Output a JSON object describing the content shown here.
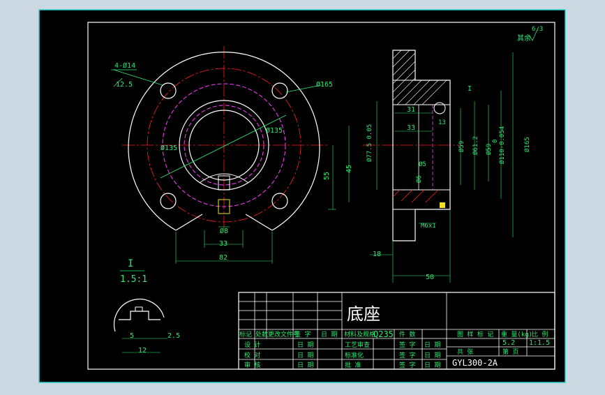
{
  "drawing": {
    "part_name": "底座",
    "material": "Q235",
    "drawing_number": "GYL300-2A",
    "mass": "5.2",
    "scale": "1:1.5",
    "roughness_note": "其余",
    "roughness_value": "6.3",
    "detail_label": "I",
    "detail_scale": "1.5:1",
    "section_mark": "I"
  },
  "front_view_dims": {
    "holes": "4-Ø14",
    "hole_depth": "12.5",
    "outer_dia": "Ø165",
    "pcd_outer": "Ø135",
    "pcd_inner": "Ø135",
    "slot_w": "Ø8",
    "slot_33": "33",
    "width_82": "82",
    "height_55": "55"
  },
  "side_view_dims": {
    "d31": "31",
    "d33": "33",
    "d13": "13",
    "d5": "Ø5",
    "d6": "Ø6",
    "d45": "45",
    "d18": "18",
    "d50": "50",
    "d77": "Ø77.5 0.05",
    "d59a": "Ø59",
    "d612": "Ø61.2",
    "d59b": "Ø59",
    "d110": "Ø110-0.054",
    "d1650": "0",
    "d165": "Ø165",
    "thread": "M6x1"
  },
  "detail_dims": {
    "d5": "5",
    "d25": "2.5",
    "d12": "12"
  },
  "title_block": {
    "h1": "标记",
    "h2": "处数",
    "h3": "更改文件号",
    "h4": "签 字",
    "h5": "日 期",
    "h6": "材料及规格",
    "h7": "件 数",
    "r1": "设 计",
    "r2": "校 对",
    "r3": "审 核",
    "date": "日 期",
    "proc": "工艺审查",
    "std": "标准化",
    "appr": "批 准",
    "sig": "签 字",
    "t1": "图 样 标 记",
    "t2": "重 量(kg)",
    "t3": "比 例",
    "sheet": "共   张",
    "page": "第   页"
  },
  "colors": {
    "frame_bg": "#000000",
    "outer_bg": "#ccd8e2",
    "border": "#2ad4d4",
    "line_white": "#ffffff",
    "center_red": "#ff2020",
    "dash_magenta": "#ff40ff",
    "dim_green": "#2ee872",
    "yellow": "#f0e020"
  }
}
